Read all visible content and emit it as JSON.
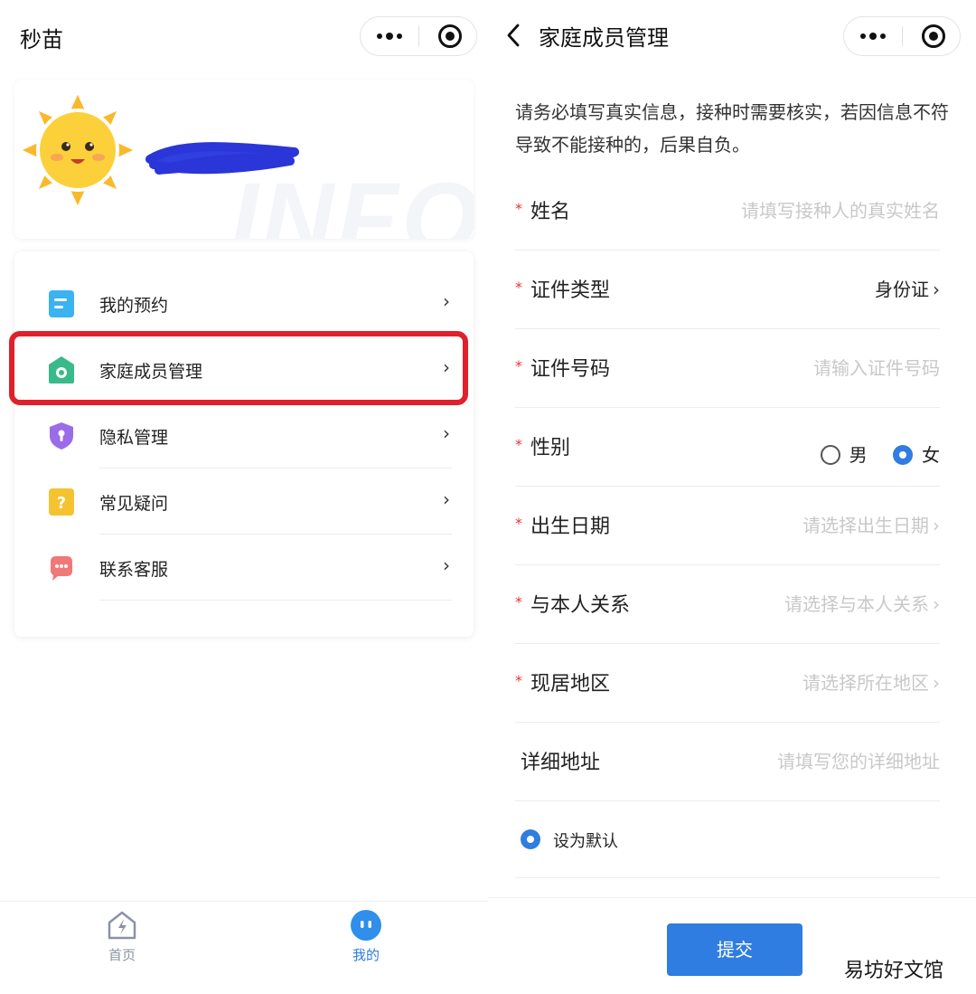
{
  "left": {
    "app_title": "秒苗",
    "profile": {
      "watermark": "INFO"
    },
    "menu": [
      {
        "label": "我的预约",
        "icon": "appointment-icon",
        "color": "#3bb3f0"
      },
      {
        "label": "家庭成员管理",
        "icon": "family-member-icon",
        "color": "#3ab98a"
      },
      {
        "label": "隐私管理",
        "icon": "privacy-shield-icon",
        "color": "#9a6ce8"
      },
      {
        "label": "常见疑问",
        "icon": "faq-icon",
        "color": "#f5c230"
      },
      {
        "label": "联系客服",
        "icon": "customer-service-icon",
        "color": "#f07878"
      }
    ],
    "highlight_color": "#e0202a",
    "tabs": [
      {
        "label": "首页",
        "icon": "home-icon",
        "active": false
      },
      {
        "label": "我的",
        "icon": "mine-icon",
        "active": true
      }
    ]
  },
  "right": {
    "page_title": "家庭成员管理",
    "notice": "请务必填写真实信息，接种时需要核实，若因信息不符导致不能接种的，后果自负。",
    "fields": [
      {
        "label": "姓名",
        "required": true,
        "placeholder": "请填写接种人的真实姓名"
      },
      {
        "label": "证件类型",
        "required": true,
        "value": "身份证"
      },
      {
        "label": "证件号码",
        "required": true,
        "placeholder": "请输入证件号码"
      },
      {
        "label": "性别",
        "required": true,
        "options": [
          "男",
          "女"
        ],
        "selected": "女"
      },
      {
        "label": "出生日期",
        "required": true,
        "placeholder": "请选择出生日期"
      },
      {
        "label": "与本人关系",
        "required": true,
        "placeholder": "请选择与本人关系"
      },
      {
        "label": "现居地区",
        "required": true,
        "placeholder": "请选择所在地区"
      },
      {
        "label": "详细地址",
        "required": false,
        "placeholder": "请填写您的详细地址"
      }
    ],
    "required_mark": "*",
    "chevron": "›",
    "set_default": {
      "label": "设为默认",
      "checked": true
    },
    "submit_label": "提交",
    "site_watermark": "易坊好文馆",
    "accent_color": "#2f7de1"
  }
}
